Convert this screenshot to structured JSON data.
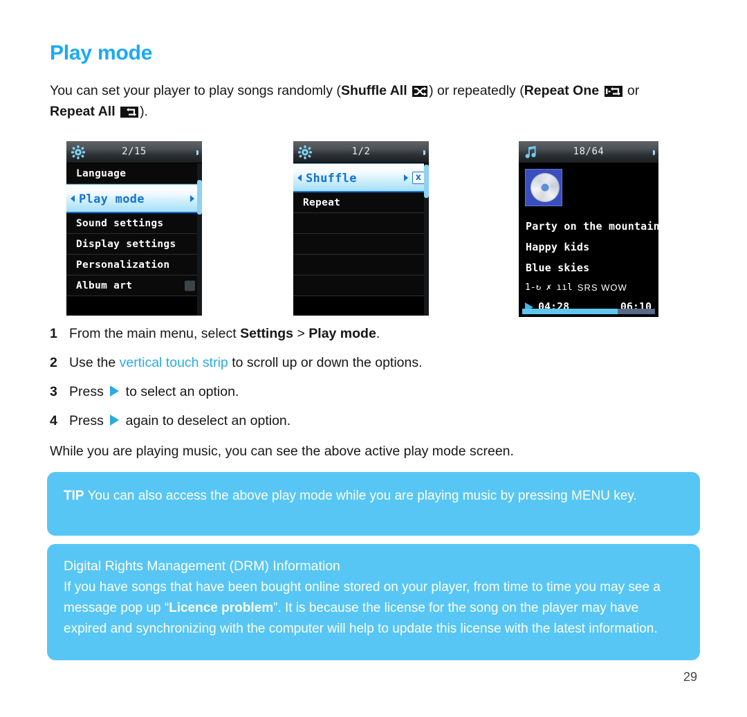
{
  "page": {
    "title": "Play mode",
    "number": "29",
    "title_color": "#1BA9F5",
    "link_color": "#29ABE2",
    "callout_color": "#57C6F4"
  },
  "intro": {
    "part1": "You can set your player to play songs randomly (",
    "shuffle_all_label": "Shuffle All",
    "shuffle_all_icon": "shuffle-all-icon",
    "part2": ") or repeatedly (",
    "repeat_one_label": "Repeat One",
    "repeat_one_icon": "repeat-one-icon",
    "part3": " or ",
    "repeat_all_label": "Repeat All",
    "repeat_all_icon": "repeat-all-icon",
    "part4": ")."
  },
  "screens": [
    {
      "name": "settings-menu-screen",
      "statusbar": {
        "icon": "gear-icon",
        "page_indicator": "2/15",
        "battery": "full"
      },
      "rows": [
        {
          "label": "Language",
          "selected": false
        },
        {
          "label": "Play mode",
          "selected": true,
          "left_arrow": true,
          "right_arrow": true
        },
        {
          "label": "Sound settings",
          "selected": false
        },
        {
          "label": "Display settings",
          "selected": false
        },
        {
          "label": "Personalization",
          "selected": false
        },
        {
          "label": "Album art",
          "selected": false,
          "toggle_box": true
        }
      ]
    },
    {
      "name": "play-mode-menu-screen",
      "statusbar": {
        "icon": "gear-icon",
        "page_indicator": "1/2",
        "battery": "full"
      },
      "rows": [
        {
          "label": "Shuffle",
          "selected": true,
          "left_arrow": true,
          "right_arrow": true,
          "checkbox": "x"
        },
        {
          "label": "Repeat",
          "selected": false
        },
        {
          "label": "",
          "selected": false
        },
        {
          "label": "",
          "selected": false
        },
        {
          "label": "",
          "selected": false
        },
        {
          "label": "",
          "selected": false
        }
      ]
    },
    {
      "name": "now-playing-screen",
      "statusbar": {
        "icon": "music-note-icon",
        "page_indicator": "18/64",
        "battery": "partial"
      },
      "album_art_icon": "cd-album-art",
      "track_title": "Party on the mountain",
      "artist": "Happy kids",
      "album": "Blue skies",
      "mode_icons": [
        {
          "name": "repeat-one-icon",
          "glyph": "1-↻"
        },
        {
          "name": "shuffle-icon",
          "glyph": "✗"
        },
        {
          "name": "equalizer-icon",
          "glyph": "ııl"
        }
      ],
      "audio_effect": "SRS WOW",
      "play_state_icon": "play-icon",
      "elapsed": "04:28",
      "total": "06:10",
      "progress_percent": 72
    }
  ],
  "steps": [
    {
      "num": "1",
      "text_before": "From the main menu, select ",
      "bold1": "Settings",
      "mid": " > ",
      "bold2": "Play mode",
      "text_after": "."
    },
    {
      "num": "2",
      "text_before": "Use the ",
      "link": "vertical touch strip",
      "text_after": " to scroll up or down the options."
    },
    {
      "num": "3",
      "text_before": "Press ",
      "icon": "play-arrow-icon",
      "text_after": " to select an option."
    },
    {
      "num": "4",
      "text_before": "Press ",
      "icon": "play-arrow-icon",
      "text_after": " again to deselect an option."
    }
  ],
  "note": "While you are playing music, you can see the above active play mode screen.",
  "tip_box": {
    "label": "TIP",
    "text": " You can also access the above play mode while you are playing music by pressing MENU key."
  },
  "drm_box": {
    "heading": "Digital Rights Management (DRM) Information",
    "text_before": "If you have songs that have been bought online stored on your player, from time to time you may see a message pop up “",
    "bold": "Licence problem",
    "text_after": "”. It is because the license for the song on the player may have expired and synchronizing with the computer will help to update this license with the latest information."
  }
}
